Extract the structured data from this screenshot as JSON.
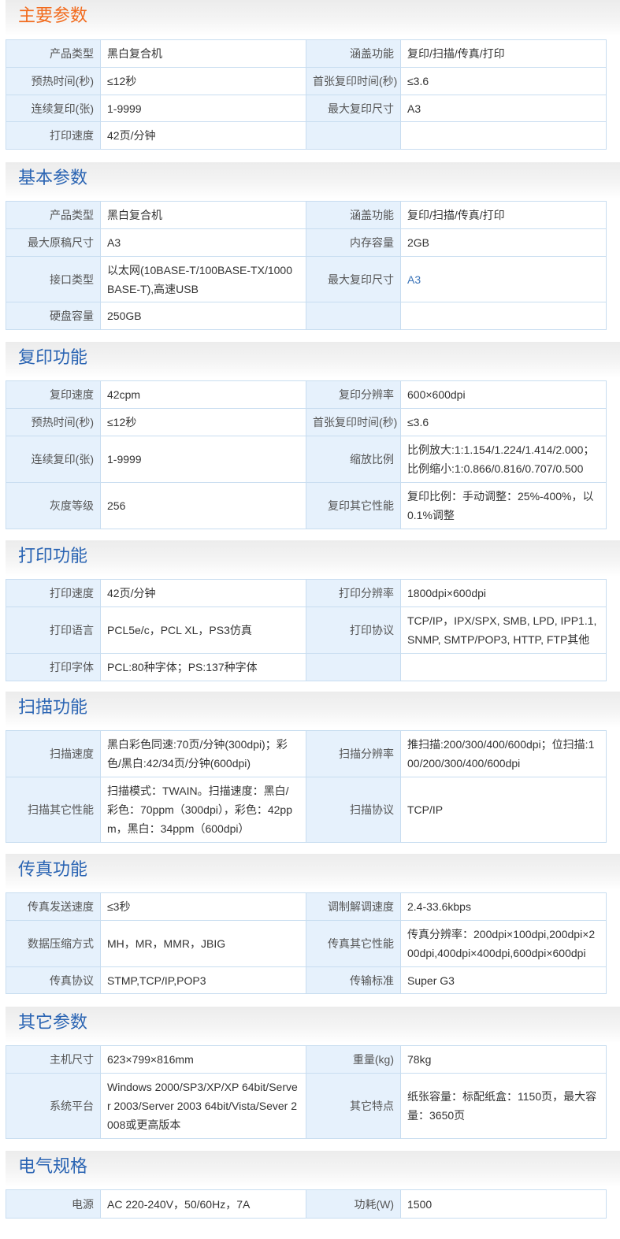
{
  "colors": {
    "title_first": "#f26b1d",
    "title": "#2a64b3",
    "label_bg": "#e6f1fc",
    "border": "#c8ddf0",
    "link": "#3a73b8"
  },
  "sections": [
    {
      "title": "主要参数",
      "rows": [
        [
          "产品类型",
          "黑白复合机",
          "涵盖功能",
          "复印/扫描/传真/打印"
        ],
        [
          "预热时间(秒)",
          "≤12秒",
          "首张复印时间(秒)",
          "≤3.6"
        ],
        [
          "连续复印(张)",
          "1-9999",
          "最大复印尺寸",
          "A3"
        ],
        [
          "打印速度",
          "42页/分钟",
          "",
          ""
        ]
      ]
    },
    {
      "title": "基本参数",
      "rows": [
        [
          "产品类型",
          "黑白复合机",
          "涵盖功能",
          "复印/扫描/传真/打印"
        ],
        [
          "最大原稿尺寸",
          "A3",
          "内存容量",
          "2GB"
        ],
        [
          "接口类型",
          "以太网(10BASE-T/100BASE-TX/1000BASE-T),高速USB",
          "最大复印尺寸",
          "A3"
        ],
        [
          "硬盘容量",
          "250GB",
          "",
          ""
        ]
      ]
    },
    {
      "title": "复印功能",
      "rows": [
        [
          "复印速度",
          "42cpm",
          "复印分辨率",
          "600×600dpi"
        ],
        [
          "预热时间(秒)",
          "≤12秒",
          "首张复印时间(秒)",
          "≤3.6"
        ],
        [
          "连续复印(张)",
          "1-9999",
          "缩放比例",
          "比例放大:1:1.154/1.224/1.414/2.000；比例缩小:1:0.866/0.816/0.707/0.500"
        ],
        [
          "灰度等级",
          "256",
          "复印其它性能",
          "复印比例：手动调整：25%-400%，以0.1%调整"
        ]
      ]
    },
    {
      "title": "打印功能",
      "rows": [
        [
          "打印速度",
          "42页/分钟",
          "打印分辨率",
          "1800dpi×600dpi"
        ],
        [
          "打印语言",
          "PCL5e/c，PCL XL，PS3仿真",
          "打印协议",
          "TCP/IP，IPX/SPX, SMB, LPD, IPP1.1, SNMP, SMTP/POP3, HTTP, FTP其他"
        ],
        [
          "打印字体",
          "PCL:80种字体；PS:137种字体",
          "",
          ""
        ]
      ]
    },
    {
      "title": "扫描功能",
      "rows": [
        [
          "扫描速度",
          "黑白彩色同速:70页/分钟(300dpi)；彩色/黑白:42/34页/分钟(600dpi)",
          "扫描分辨率",
          "推扫描:200/300/400/600dpi；位扫描:100/200/300/400/600dpi"
        ],
        [
          "扫描其它性能",
          "扫描模式：TWAIN。扫描速度：黑白/彩色：70ppm（300dpi），彩色：42ppm，黑白：34ppm（600dpi）",
          "扫描协议",
          "TCP/IP"
        ]
      ]
    },
    {
      "title": "传真功能",
      "rows": [
        [
          "传真发送速度",
          "≤3秒",
          "调制解调速度",
          "2.4-33.6kbps"
        ],
        [
          "数据压缩方式",
          "MH，MR，MMR，JBIG",
          "传真其它性能",
          "传真分辨率：200dpi×100dpi,200dpi×200dpi,400dpi×400dpi,600dpi×600dpi"
        ],
        [
          "传真协议",
          "STMP,TCP/IP,POP3",
          "传输标准",
          "Super G3"
        ]
      ]
    },
    {
      "title": "其它参数",
      "rows": [
        [
          "主机尺寸",
          "623×799×816mm",
          "重量(kg)",
          "78kg"
        ],
        [
          "系统平台",
          "Windows 2000/SP3/XP/XP 64bit/Server 2003/Server 2003 64bit/Vista/Sever 2008或更高版本",
          "其它特点",
          "纸张容量：标配纸盒：1150页，最大容量：3650页"
        ]
      ]
    },
    {
      "title": "电气规格",
      "rows": [
        [
          "电源",
          "AC 220-240V，50/60Hz，7A",
          "功耗(W)",
          "1500"
        ]
      ]
    }
  ]
}
